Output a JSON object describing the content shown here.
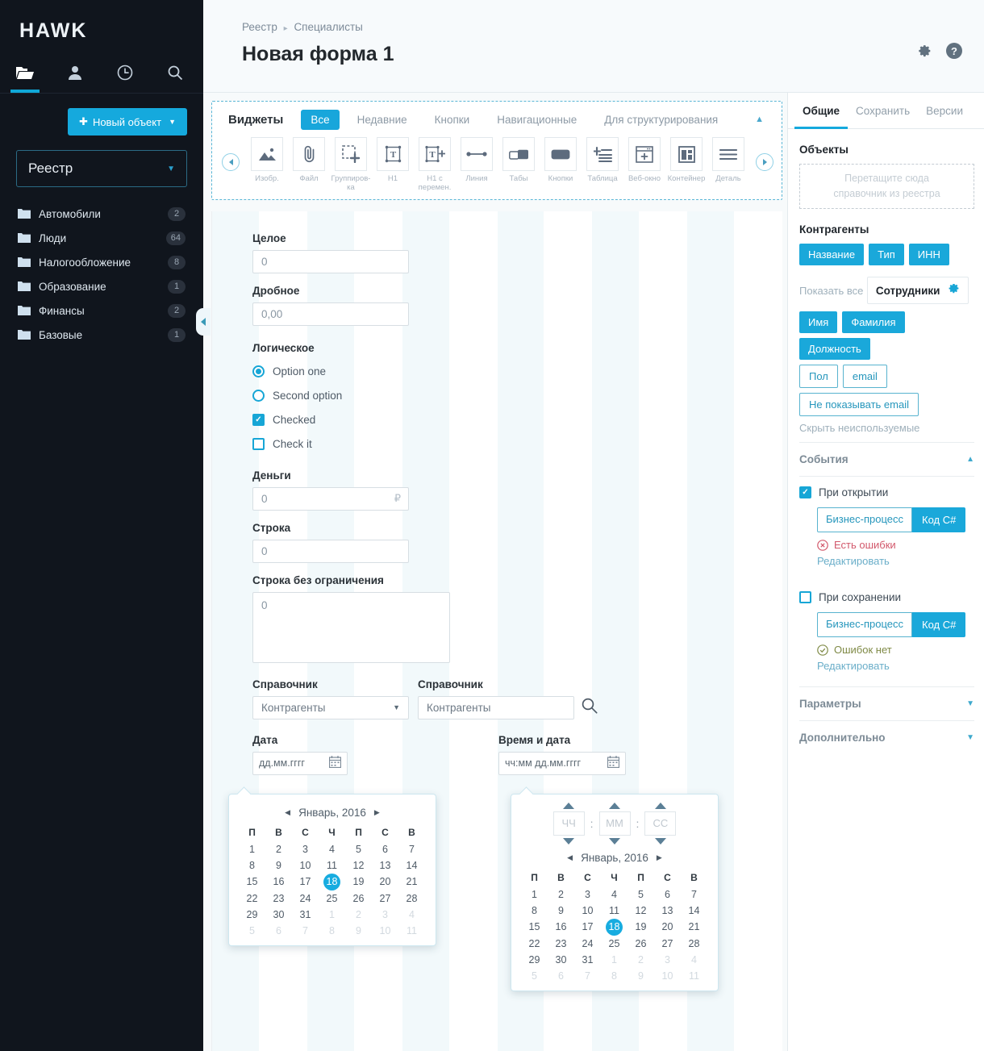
{
  "brand": {
    "logo": "HAWK"
  },
  "sidebar": {
    "nav_tabs": [
      {
        "name": "folder-icon",
        "active": true
      },
      {
        "name": "user-icon",
        "active": false
      },
      {
        "name": "clock-icon",
        "active": false
      },
      {
        "name": "search-icon",
        "active": false
      }
    ],
    "new_object_button": "Новый объект",
    "registry_select": "Реестр",
    "folders": [
      {
        "label": "Автомобили",
        "count": "2"
      },
      {
        "label": "Люди",
        "count": "64"
      },
      {
        "label": "Налогообложение",
        "count": "8"
      },
      {
        "label": "Образование",
        "count": "1"
      },
      {
        "label": "Финансы",
        "count": "2"
      },
      {
        "label": "Базовые",
        "count": "1"
      }
    ]
  },
  "header": {
    "breadcrumb_root": "Реестр",
    "breadcrumb_sep": "▸",
    "breadcrumb_current": "Специалисты",
    "title": "Новая форма 1"
  },
  "widgets": {
    "title": "Виджеты",
    "tabs": [
      {
        "label": "Все",
        "active": true
      },
      {
        "label": "Недавние",
        "active": false
      },
      {
        "label": "Кнопки",
        "active": false
      },
      {
        "label": "Навигационные",
        "active": false
      },
      {
        "label": "Для структурирования",
        "active": false
      }
    ],
    "items": [
      {
        "label": "Изобр.",
        "icon": "image-icon"
      },
      {
        "label": "Файл",
        "icon": "paperclip-icon"
      },
      {
        "label": "Группиров-ка",
        "icon": "group-icon"
      },
      {
        "label": "H1",
        "icon": "heading-icon"
      },
      {
        "label": "H1 с перемен.",
        "icon": "heading-var-icon"
      },
      {
        "label": "Линия",
        "icon": "line-icon"
      },
      {
        "label": "Табы",
        "icon": "tabs-icon"
      },
      {
        "label": "Кнопки",
        "icon": "button-icon"
      },
      {
        "label": "Таблица",
        "icon": "table-icon"
      },
      {
        "label": "Веб-окно",
        "icon": "webwindow-icon"
      },
      {
        "label": "Контейнер",
        "icon": "container-icon"
      },
      {
        "label": "Деталь",
        "icon": "detail-icon"
      }
    ]
  },
  "form": {
    "integer": {
      "label": "Целое",
      "value": "0"
    },
    "decimal": {
      "label": "Дробное",
      "value": "0,00"
    },
    "boolean": {
      "label": "Логическое",
      "radio_one": "Option one",
      "radio_two": "Second option",
      "check_one": "Checked",
      "check_two": "Check it"
    },
    "money": {
      "label": "Деньги",
      "value": "0",
      "currency": "₽"
    },
    "string": {
      "label": "Строка",
      "value": "0"
    },
    "text": {
      "label": "Строка без ограничения",
      "value": "0"
    },
    "ref_select": {
      "label": "Справочник",
      "value": "Контрагенты"
    },
    "ref_search": {
      "label": "Справочник",
      "value": "Контрагенты"
    },
    "date": {
      "label": "Дата",
      "value": "дд.мм.гггг"
    },
    "datetime": {
      "label": "Время и дата",
      "value": "чч:мм  дд.мм.гггг"
    }
  },
  "calendar": {
    "month_title": "Январь, 2016",
    "prev": "◀",
    "next": "▶",
    "weekdays": [
      "П",
      "В",
      "С",
      "Ч",
      "П",
      "С",
      "В"
    ],
    "selected_day": "18",
    "weeks": [
      [
        "1",
        "2",
        "3",
        "4",
        "5",
        "6",
        "7"
      ],
      [
        "8",
        "9",
        "10",
        "11",
        "12",
        "13",
        "14"
      ],
      [
        "15",
        "16",
        "17",
        "18",
        "19",
        "20",
        "21"
      ],
      [
        "22",
        "23",
        "24",
        "25",
        "26",
        "27",
        "28"
      ],
      [
        "29",
        "30",
        "31",
        "1",
        "2",
        "3",
        "4"
      ],
      [
        "5",
        "6",
        "7",
        "8",
        "9",
        "10",
        "11"
      ]
    ],
    "muted_from_week": 4,
    "time": {
      "hh": "ЧЧ",
      "mm": "ММ",
      "ss": "СС",
      "sep": ":"
    }
  },
  "right_panel": {
    "tabs": [
      {
        "label": "Общие",
        "active": true
      },
      {
        "label": "Сохранить",
        "active": false
      },
      {
        "label": "Версии",
        "active": false
      }
    ],
    "objects": {
      "title": "Объекты",
      "dropzone_line1": "Перетащите сюда",
      "dropzone_line2": "справочник из реестра"
    },
    "contractors": {
      "title": "Контрагенты",
      "chips": [
        "Название",
        "Тип",
        "ИНН"
      ],
      "show_all": "Показать все"
    },
    "employees": {
      "title": "Сотрудники",
      "chips_filled": [
        "Имя",
        "Фамилия",
        "Должность"
      ],
      "chips_outline": [
        "Пол",
        "email",
        "Не показывать email"
      ],
      "hide_unused": "Скрыть неиспользуемые"
    },
    "events": {
      "title": "События",
      "on_open": {
        "label": "При открытии",
        "checked": true,
        "seg_left": "Бизнес-процесс",
        "seg_right": "Код C#",
        "status": "Есть ошибки",
        "status_type": "error",
        "edit": "Редактировать"
      },
      "on_save": {
        "label": "При сохранении",
        "checked": false,
        "seg_left": "Бизнес-процесс",
        "seg_right": "Код C#",
        "status": "Ошибок нет",
        "status_type": "ok",
        "edit": "Редактировать"
      }
    },
    "parameters": {
      "title": "Параметры"
    },
    "additional": {
      "title": "Дополнительно"
    }
  },
  "colors": {
    "accent": "#15a9dd",
    "sidebar_bg": "#10151d",
    "error": "#d2586b",
    "ok": "#7f8a46"
  }
}
